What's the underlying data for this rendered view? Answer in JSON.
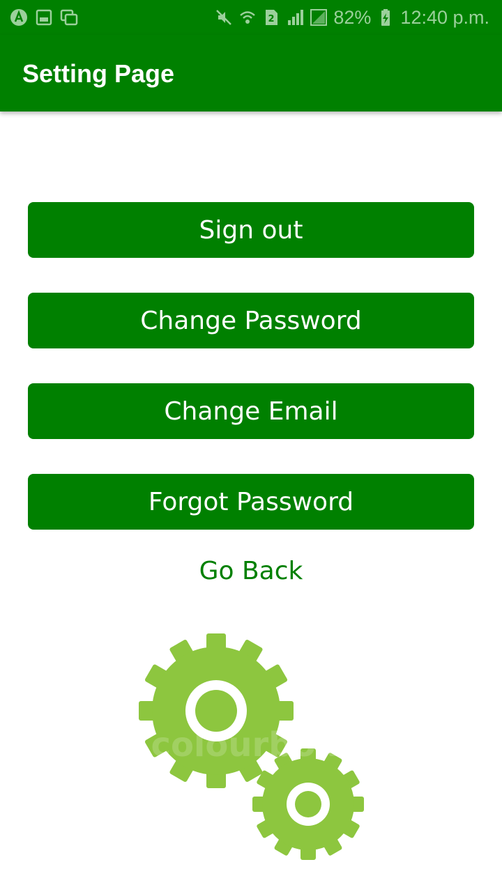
{
  "status_bar": {
    "left_icons": [
      "app-notification-icon",
      "image-notification-icon",
      "gallery-notification-icon"
    ],
    "right_icons": [
      "mute-icon",
      "wifi-icon",
      "sim-icon",
      "signal-icon",
      "no-signal-icon"
    ],
    "battery": "82%",
    "time": "12:40 p.m."
  },
  "app_bar": {
    "title": "Setting Page",
    "color": "#008000"
  },
  "buttons": {
    "sign_out": "Sign out",
    "change_password": "Change Password",
    "change_email": "Change Email",
    "forgot_password": "Forgot Password"
  },
  "go_back": "Go Back",
  "illustration": {
    "icon": "gears-icon",
    "color": "#8dc63f",
    "watermark": "colourbox"
  }
}
